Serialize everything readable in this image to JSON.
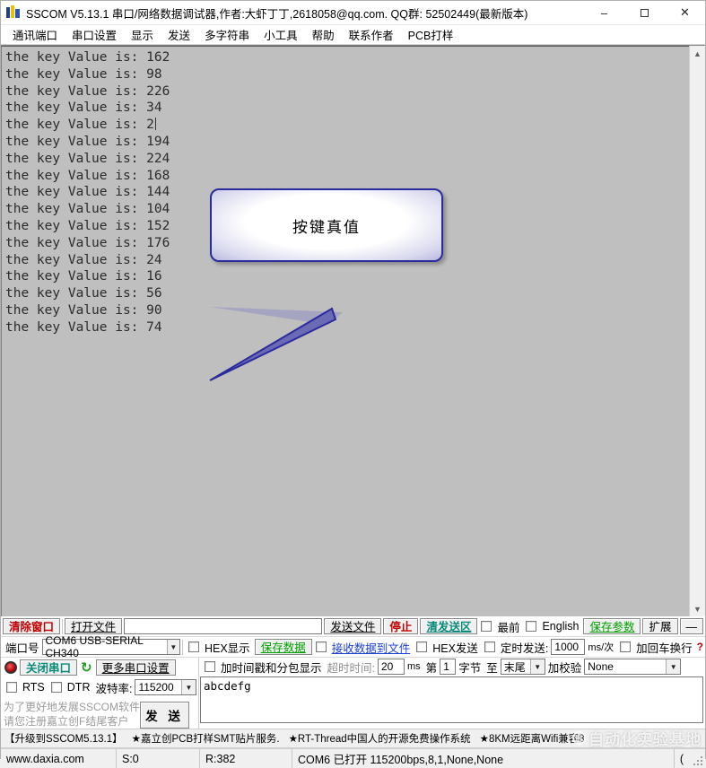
{
  "window": {
    "title": "SSCOM V5.13.1 串口/网络数据调试器,作者:大虾丁丁,2618058@qq.com. QQ群: 52502449(最新版本)",
    "icon": "sscom-app-icon",
    "minimize": "–",
    "maximize": "□",
    "close": "✕"
  },
  "menu": {
    "items": [
      {
        "label": "通讯端口"
      },
      {
        "label": "串口设置"
      },
      {
        "label": "显示"
      },
      {
        "label": "发送"
      },
      {
        "label": "多字符串"
      },
      {
        "label": "小工具"
      },
      {
        "label": "帮助"
      },
      {
        "label": "联系作者"
      },
      {
        "label": "PCB打样"
      }
    ]
  },
  "receive": {
    "line_prefix": "the key Value is: ",
    "lines": [
      "the key Value is: 162",
      "the key Value is: 98",
      "the key Value is: 226",
      "the key Value is: 34",
      "the key Value is: 2",
      "the key Value is: 194",
      "the key Value is: 224",
      "the key Value is: 168",
      "the key Value is: 144",
      "the key Value is: 104",
      "the key Value is: 152",
      "the key Value is: 176",
      "the key Value is: 24",
      "the key Value is: 16",
      "the key Value is: 56",
      "the key Value is: 90",
      "the key Value is: 74"
    ],
    "values": [
      162,
      98,
      226,
      34,
      2,
      194,
      224,
      168,
      144,
      104,
      152,
      176,
      24,
      16,
      56,
      90,
      74
    ],
    "background_color": "#bfbfbf",
    "text_color": "#2b2b2b"
  },
  "callout": {
    "text": "按键真值",
    "border_color": "#2b2b9e",
    "fill_color": "#ffffff"
  },
  "scrollbar": {
    "up_arrow": "▲",
    "down_arrow": "▼"
  },
  "toolbar_row1": {
    "clear_window": "清除窗口",
    "open_file": "打开文件",
    "file_path": "",
    "file_path_placeholder": "",
    "send_file": "发送文件",
    "stop": "停止",
    "clear_send": "清发送区",
    "topmost": "最前",
    "english": "English",
    "save_params": "保存参数",
    "extend": "扩展",
    "collapse": "—"
  },
  "port_row": {
    "port_label": "端口号",
    "port_value": "COM6 USB-SERIAL CH340",
    "hex_display": "HEX显示",
    "save_data": "保存数据",
    "recv_to_file": "接收数据到文件",
    "hex_send": "HEX发送",
    "timed_send": "定时发送:",
    "timed_interval": "1000",
    "interval_unit": "ms/次",
    "add_crlf": "加回车换行",
    "help_mark": "?"
  },
  "serial_row": {
    "close_port": "关闭串口",
    "refresh_icon": "refresh-icon",
    "more_settings": "更多串口设置",
    "rts": "RTS",
    "dtr": "DTR",
    "baud_label": "波特率:",
    "baud_value": "115200",
    "timestamp_pkg": "加时间戳和分包显示",
    "timeout_label": "超时时间:",
    "timeout_value": "20",
    "timeout_unit": "ms",
    "byte_from_label": "第",
    "byte_from_value": "1",
    "byte_label": "字节",
    "byte_to_label": "至",
    "byte_to_value": "末尾",
    "checksum_label": "加校验",
    "checksum_value": "None"
  },
  "send_area": {
    "register_note_line1": "为了更好地发展SSCOM软件",
    "register_note_line2": "请您注册嘉立创F结尾客户",
    "send_button": "发 送",
    "send_text": "abcdefg"
  },
  "ad_bar": {
    "pieces": [
      "【升级到SSCOM5.13.1】",
      "★嘉立创PCB打样SMT贴片服务.",
      "★RT-Thread中国人的开源免费操作系统",
      "★8KM远距离Wifi兼容8"
    ],
    "watermark": "自动化实验基地"
  },
  "status_bar": {
    "website": "www.daxia.com",
    "sent": "S:0",
    "received": "R:382",
    "connection": "COM6 已打开  115200bps,8,1,None,None",
    "tail": "("
  }
}
